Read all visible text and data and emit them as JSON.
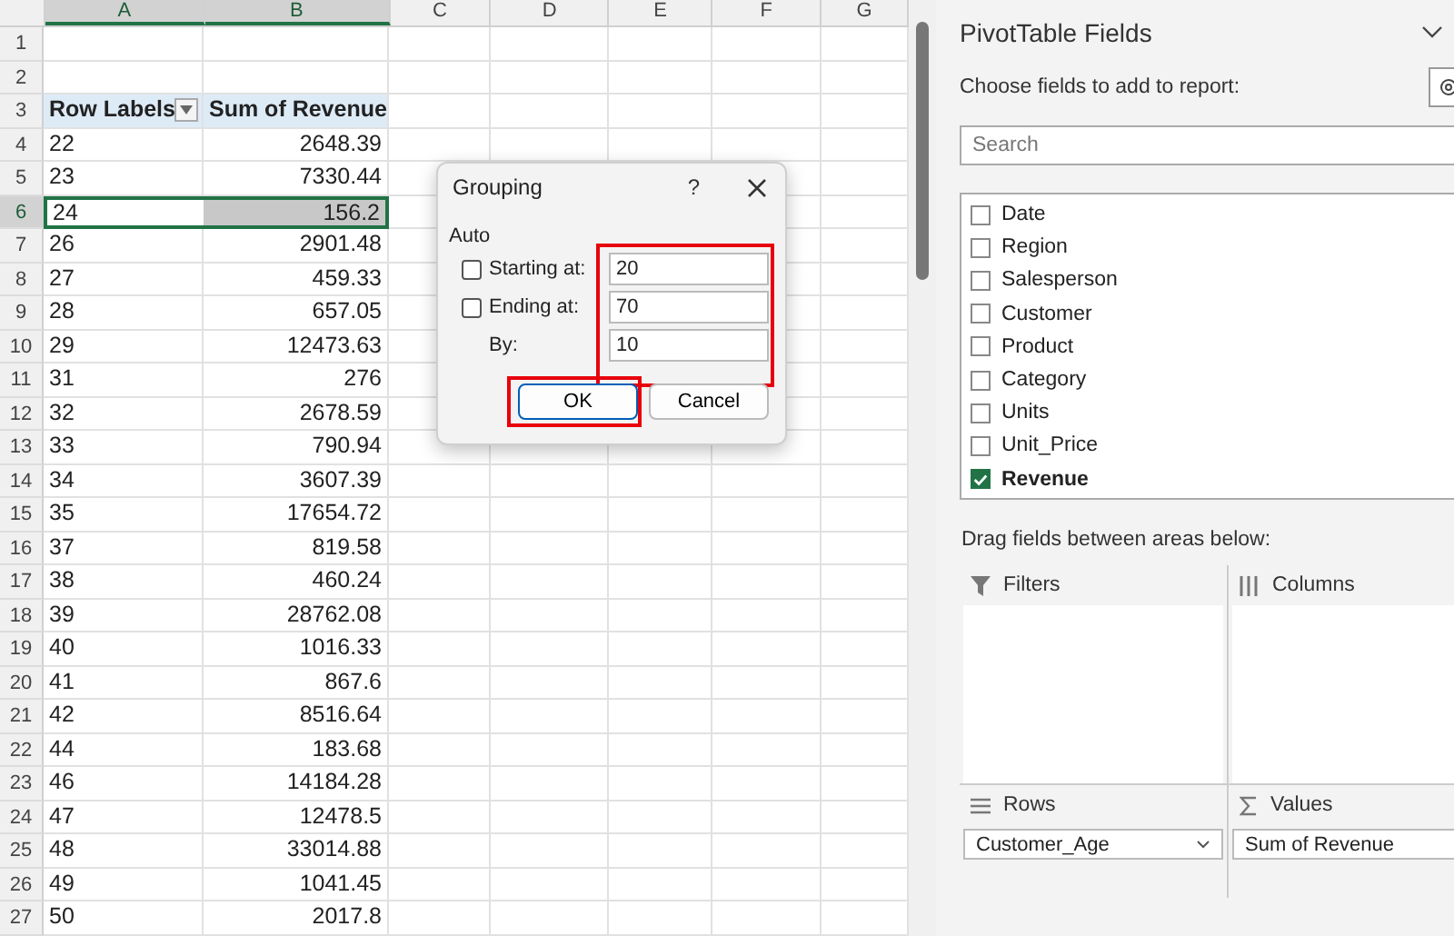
{
  "sheet": {
    "columns": [
      {
        "label": "A",
        "selected": true
      },
      {
        "label": "B",
        "selected": true
      },
      {
        "label": "C",
        "selected": false
      },
      {
        "label": "D",
        "selected": false
      },
      {
        "label": "E",
        "selected": false
      },
      {
        "label": "F",
        "selected": false
      },
      {
        "label": "G",
        "selected": false
      }
    ],
    "rows": [
      {
        "number": "1",
        "kind": "empty",
        "selected": false
      },
      {
        "number": "2",
        "kind": "empty",
        "selected": false
      },
      {
        "number": "3",
        "kind": "header",
        "label": "Row Labels",
        "value": "Sum of Revenue",
        "selected": false
      },
      {
        "number": "4",
        "kind": "data",
        "label": "22",
        "value": "2648.39",
        "selected": false
      },
      {
        "number": "5",
        "kind": "data",
        "label": "23",
        "value": "7330.44",
        "selected": false
      },
      {
        "number": "6",
        "kind": "data",
        "label": "24",
        "value": "156.2",
        "selected": true
      },
      {
        "number": "7",
        "kind": "data",
        "label": "26",
        "value": "2901.48",
        "selected": false
      },
      {
        "number": "8",
        "kind": "data",
        "label": "27",
        "value": "459.33",
        "selected": false
      },
      {
        "number": "9",
        "kind": "data",
        "label": "28",
        "value": "657.05",
        "selected": false
      },
      {
        "number": "10",
        "kind": "data",
        "label": "29",
        "value": "12473.63",
        "selected": false
      },
      {
        "number": "11",
        "kind": "data",
        "label": "31",
        "value": "276",
        "selected": false
      },
      {
        "number": "12",
        "kind": "data",
        "label": "32",
        "value": "2678.59",
        "selected": false
      },
      {
        "number": "13",
        "kind": "data",
        "label": "33",
        "value": "790.94",
        "selected": false
      },
      {
        "number": "14",
        "kind": "data",
        "label": "34",
        "value": "3607.39",
        "selected": false
      },
      {
        "number": "15",
        "kind": "data",
        "label": "35",
        "value": "17654.72",
        "selected": false
      },
      {
        "number": "16",
        "kind": "data",
        "label": "37",
        "value": "819.58",
        "selected": false
      },
      {
        "number": "17",
        "kind": "data",
        "label": "38",
        "value": "460.24",
        "selected": false
      },
      {
        "number": "18",
        "kind": "data",
        "label": "39",
        "value": "28762.08",
        "selected": false
      },
      {
        "number": "19",
        "kind": "data",
        "label": "40",
        "value": "1016.33",
        "selected": false
      },
      {
        "number": "20",
        "kind": "data",
        "label": "41",
        "value": "867.6",
        "selected": false
      },
      {
        "number": "21",
        "kind": "data",
        "label": "42",
        "value": "8516.64",
        "selected": false
      },
      {
        "number": "22",
        "kind": "data",
        "label": "44",
        "value": "183.68",
        "selected": false
      },
      {
        "number": "23",
        "kind": "data",
        "label": "46",
        "value": "14184.28",
        "selected": false
      },
      {
        "number": "24",
        "kind": "data",
        "label": "47",
        "value": "12478.5",
        "selected": false
      },
      {
        "number": "25",
        "kind": "data",
        "label": "48",
        "value": "33014.88",
        "selected": false
      },
      {
        "number": "26",
        "kind": "data",
        "label": "49",
        "value": "1041.45",
        "selected": false
      },
      {
        "number": "27",
        "kind": "data",
        "label": "50",
        "value": "2017.8",
        "selected": false
      }
    ]
  },
  "dialog": {
    "title": "Grouping",
    "help": "?",
    "section": "Auto",
    "fields": [
      {
        "kind": "check",
        "label": "Starting at:",
        "checked": false,
        "value": "20"
      },
      {
        "kind": "check",
        "label": "Ending at:",
        "checked": false,
        "value": "70"
      },
      {
        "kind": "plain",
        "label": "By:",
        "value": "10"
      }
    ],
    "buttons": [
      {
        "label": "OK",
        "default": true
      },
      {
        "label": "Cancel",
        "default": false
      }
    ]
  },
  "pane": {
    "title": "PivotTable Fields",
    "prompt": "Choose fields to add to report:",
    "search": {
      "placeholder": "Search"
    },
    "fields": [
      {
        "label": "Date",
        "checked": false
      },
      {
        "label": "Region",
        "checked": false
      },
      {
        "label": "Salesperson",
        "checked": false
      },
      {
        "label": "Customer",
        "checked": false
      },
      {
        "label": "Product",
        "checked": false
      },
      {
        "label": "Category",
        "checked": false
      },
      {
        "label": "Units",
        "checked": false
      },
      {
        "label": "Unit_Price",
        "checked": false
      },
      {
        "label": "Revenue",
        "checked": true
      }
    ],
    "areas_prompt": "Drag fields between areas below:",
    "areas": [
      {
        "kind": "filters",
        "label": "Filters"
      },
      {
        "kind": "columns",
        "label": "Columns"
      },
      {
        "kind": "rows",
        "label": "Rows",
        "items": [
          "Customer_Age"
        ]
      },
      {
        "kind": "values",
        "label": "Values",
        "items": [
          "Sum of Revenue"
        ]
      }
    ]
  }
}
